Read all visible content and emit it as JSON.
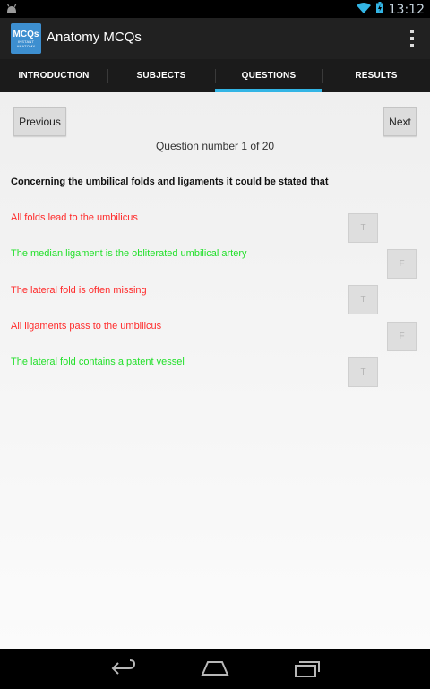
{
  "status_bar": {
    "time": "13:12"
  },
  "app": {
    "title": "Anatomy MCQs",
    "logo_main": "MCQs",
    "logo_sub": "INSTANT ANATOMY"
  },
  "tabs": [
    {
      "label": "INTRODUCTION"
    },
    {
      "label": "SUBJECTS"
    },
    {
      "label": "QUESTIONS"
    },
    {
      "label": "RESULTS"
    }
  ],
  "question": {
    "previous_label": "Previous",
    "next_label": "Next",
    "number_text": "Question number 1 of 20",
    "text": "Concerning the umbilical folds and ligaments it could be stated that",
    "options": [
      {
        "text": "All folds lead to the umbilicus",
        "answer": "T",
        "color": "#ff2a2a"
      },
      {
        "text": "The median ligament is the obliterated umbilical artery",
        "answer": "F",
        "color": "#22e02a"
      },
      {
        "text": "The lateral fold is often missing",
        "answer": "T",
        "color": "#ff2a2a"
      },
      {
        "text": "All ligaments pass to the umbilicus",
        "answer": "F",
        "color": "#ff2a2a"
      },
      {
        "text": "The lateral fold contains a patent vessel",
        "answer": "T",
        "color": "#22e02a"
      }
    ]
  },
  "colors": {
    "accent": "#33b5e5",
    "wrong": "#ff2a2a",
    "correct": "#22e02a"
  }
}
